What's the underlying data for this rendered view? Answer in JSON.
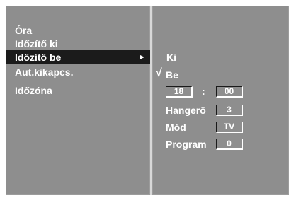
{
  "left_menu": {
    "items": [
      {
        "label": "Óra"
      },
      {
        "label": "Időzítő  ki"
      },
      {
        "label": "Időzítő be",
        "selected": true,
        "arrow": "►"
      },
      {
        "label": "Aut.kikapcs."
      },
      {
        "label": "Időzóna"
      }
    ]
  },
  "right_panel": {
    "option_off": "Ki",
    "check_mark": "√",
    "option_on": "Be",
    "time": {
      "hour": "18",
      "separator": ":",
      "minute": "00"
    },
    "volume": {
      "label": "Hangerő",
      "value": "3"
    },
    "mode": {
      "label": "Mód",
      "value": "TV"
    },
    "program": {
      "label": "Program",
      "value": "0"
    }
  },
  "colors": {
    "panel": "#8e8e8e",
    "selection": "#1b1b1b",
    "text": "#ffffff"
  }
}
